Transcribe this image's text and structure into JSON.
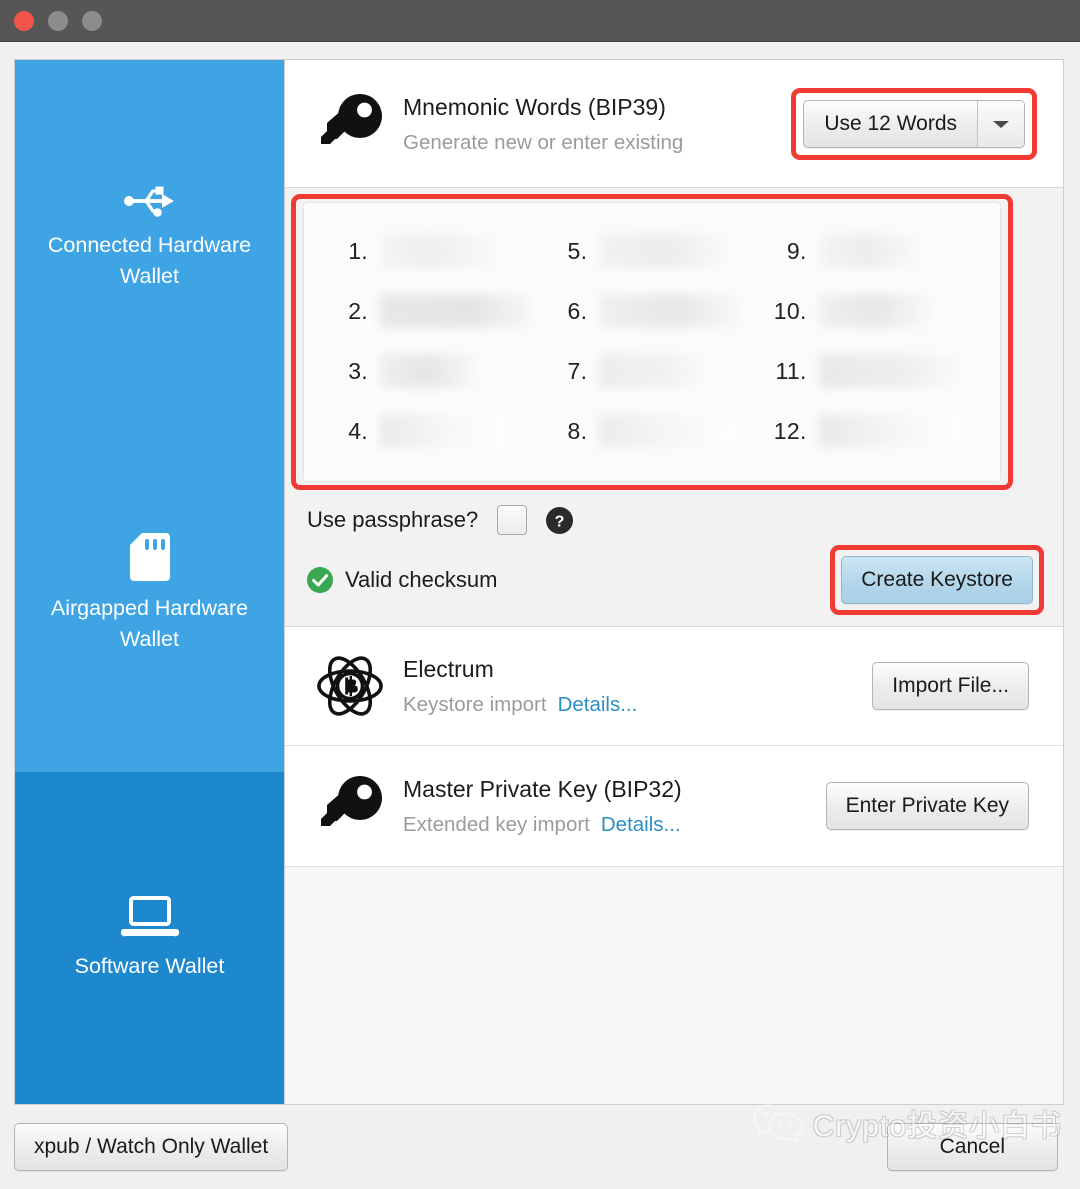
{
  "window": {
    "traffic_lights": [
      "close",
      "minimize",
      "zoom"
    ]
  },
  "sidebar": {
    "items": [
      {
        "id": "connected-hardware-wallet",
        "label": "Connected Hardware Wallet",
        "icon": "usb-icon",
        "selected": false
      },
      {
        "id": "airgapped-hardware-wallet",
        "label": "Airgapped Hardware Wallet",
        "icon": "sd-card-icon",
        "selected": false
      },
      {
        "id": "software-wallet",
        "label": "Software Wallet",
        "icon": "laptop-icon",
        "selected": true
      }
    ]
  },
  "mnemonic": {
    "icon": "key-icon",
    "title": "Mnemonic Words (BIP39)",
    "subtitle": "Generate new or enter existing",
    "word_count_button": "Use 12 Words",
    "word_count_arrow": "chevron-down-icon",
    "words": [
      {
        "number": "1.",
        "value": ""
      },
      {
        "number": "2.",
        "value": ""
      },
      {
        "number": "3.",
        "value": ""
      },
      {
        "number": "4.",
        "value": ""
      },
      {
        "number": "5.",
        "value": ""
      },
      {
        "number": "6.",
        "value": ""
      },
      {
        "number": "7.",
        "value": ""
      },
      {
        "number": "8.",
        "value": ""
      },
      {
        "number": "9.",
        "value": ""
      },
      {
        "number": "10.",
        "value": ""
      },
      {
        "number": "11.",
        "value": ""
      },
      {
        "number": "12.",
        "value": ""
      }
    ],
    "passphrase_label": "Use passphrase?",
    "passphrase_checked": false,
    "help_icon": "help-circle-icon",
    "checksum_status": "Valid checksum",
    "checksum_icon": "check-circle-icon",
    "create_button": "Create Keystore"
  },
  "electrum": {
    "icon": "electrum-atom-bitcoin-icon",
    "title": "Electrum",
    "subtitle": "Keystore import",
    "details_link": "Details...",
    "action_button": "Import File..."
  },
  "master_key": {
    "icon": "key-icon",
    "title": "Master Private Key (BIP32)",
    "subtitle": "Extended key import",
    "details_link": "Details...",
    "action_button": "Enter Private Key"
  },
  "footer": {
    "xpub_button": "xpub / Watch Only Wallet",
    "cancel_button": "Cancel"
  },
  "watermark": {
    "text": "Crypto投资小白书",
    "icon": "wechat-icon"
  },
  "colors": {
    "sidebar_blue": "#3fa4e4",
    "sidebar_selected_blue": "#1e88cf",
    "highlight_red": "#ef3b33",
    "link_blue": "#2b8fc4",
    "valid_green": "#3aa853",
    "primary_button_blue": "#b3d6ea",
    "titlebar_gray": "#565656"
  }
}
